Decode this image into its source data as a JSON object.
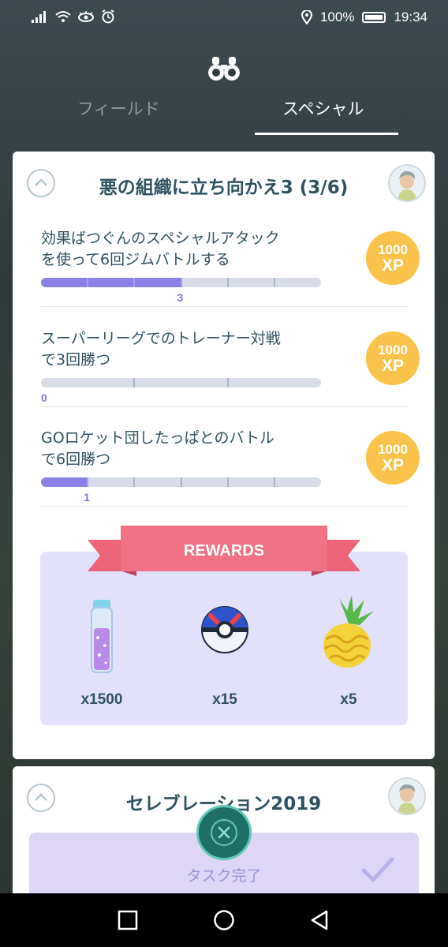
{
  "status_bar": {
    "battery": "100%",
    "time": "19:34"
  },
  "tabs": [
    {
      "label": "フィールド",
      "active": false
    },
    {
      "label": "スペシャル",
      "active": true
    }
  ],
  "research_card": {
    "title": "悪の組織に立ち向かえ3 (3/6)",
    "tasks": [
      {
        "text_line1": "効果ばつぐんのスペシャルアタック",
        "text_line2": "を使って6回ジムバトルする",
        "progress": 3,
        "goal": 6,
        "progress_label": "3",
        "xp_amount": "1000",
        "xp_unit": "XP"
      },
      {
        "text_line1": "スーパーリーグでのトレーナー対戦",
        "text_line2": "で3回勝つ",
        "progress": 0,
        "goal": 3,
        "progress_label": "0",
        "xp_amount": "1000",
        "xp_unit": "XP"
      },
      {
        "text_line1": "GOロケット団したっぱとのバトル",
        "text_line2": "で6回勝つ",
        "progress": 1,
        "goal": 6,
        "progress_label": "1",
        "xp_amount": "1000",
        "xp_unit": "XP"
      }
    ],
    "rewards_title": "REWARDS",
    "rewards": [
      {
        "icon": "stardust-icon",
        "label": "x1500"
      },
      {
        "icon": "great-ball-icon",
        "label": "x15"
      },
      {
        "icon": "golden-pinap-berry-icon",
        "label": "x5"
      }
    ]
  },
  "celebration_card": {
    "title": "セレブレーション2019",
    "status": "タスク完了"
  },
  "colors": {
    "title_text": "#2f5260",
    "progress_fill": "#8b80e8",
    "xp_badge": "#f9c24b",
    "ribbon": "#ec6478",
    "rewards_bg": "#e3e0fb"
  }
}
